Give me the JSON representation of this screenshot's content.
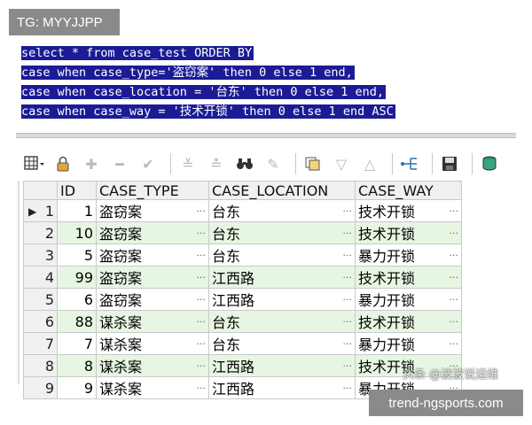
{
  "tag": "TG: MYYJJPP",
  "url": "trend-ngsports.com",
  "watermark": "头条 @波波说运维",
  "sql": [
    "select * from case_test ORDER BY",
    "case when case_type='盗窃案' then 0 else 1 end,",
    "case when case_location = '台东' then 0 else 1 end,",
    "case when case_way = '技术开锁' then 0 else 1 end ASC"
  ],
  "toolbar": {
    "icons": [
      "grid-menu-icon",
      "lock-icon",
      "plus-icon",
      "minus-icon",
      "check-icon",
      "filter-down-icon",
      "filter-clear-icon",
      "binoculars-icon",
      "edit-icon",
      "layers-icon",
      "arrow-down-icon",
      "arrow-up-icon",
      "tree-icon",
      "save-icon",
      "database-icon"
    ]
  },
  "grid": {
    "columns": [
      "ID",
      "CASE_TYPE",
      "CASE_LOCATION",
      "CASE_WAY"
    ],
    "rows": [
      {
        "n": "1",
        "id": "1",
        "type": "盗窃案",
        "loc": "台东",
        "way": "技术开锁"
      },
      {
        "n": "2",
        "id": "10",
        "type": "盗窃案",
        "loc": "台东",
        "way": "技术开锁"
      },
      {
        "n": "3",
        "id": "5",
        "type": "盗窃案",
        "loc": "台东",
        "way": "暴力开锁"
      },
      {
        "n": "4",
        "id": "99",
        "type": "盗窃案",
        "loc": "江西路",
        "way": "技术开锁"
      },
      {
        "n": "5",
        "id": "6",
        "type": "盗窃案",
        "loc": "江西路",
        "way": "暴力开锁"
      },
      {
        "n": "6",
        "id": "88",
        "type": "谋杀案",
        "loc": "台东",
        "way": "技术开锁"
      },
      {
        "n": "7",
        "id": "7",
        "type": "谋杀案",
        "loc": "台东",
        "way": "暴力开锁"
      },
      {
        "n": "8",
        "id": "8",
        "type": "谋杀案",
        "loc": "江西路",
        "way": "技术开锁"
      },
      {
        "n": "9",
        "id": "9",
        "type": "谋杀案",
        "loc": "江西路",
        "way": "暴力开锁"
      }
    ]
  }
}
